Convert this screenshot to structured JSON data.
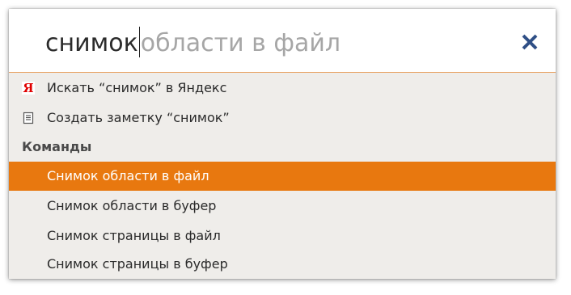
{
  "search": {
    "typed": "снимок",
    "completion": "области в файл"
  },
  "close": {
    "icon": "close-icon",
    "color": "#2f4f86"
  },
  "suggestions": [
    {
      "label": "Искать “снимок” в Яндекс",
      "icon": "yandex-icon"
    },
    {
      "label": "Создать заметку “снимок”",
      "icon": "note-icon"
    }
  ],
  "commands": {
    "header": "Команды",
    "items": [
      {
        "label": "Снимок области в файл",
        "selected": true
      },
      {
        "label": "Снимок области в буфер",
        "selected": false
      },
      {
        "label": "Снимок страницы в файл",
        "selected": false
      },
      {
        "label": "Снимок страницы в буфер",
        "selected": false
      }
    ]
  },
  "colors": {
    "accent": "#e8780f",
    "list_bg": "#efedea",
    "yandex_red": "#e00000"
  }
}
